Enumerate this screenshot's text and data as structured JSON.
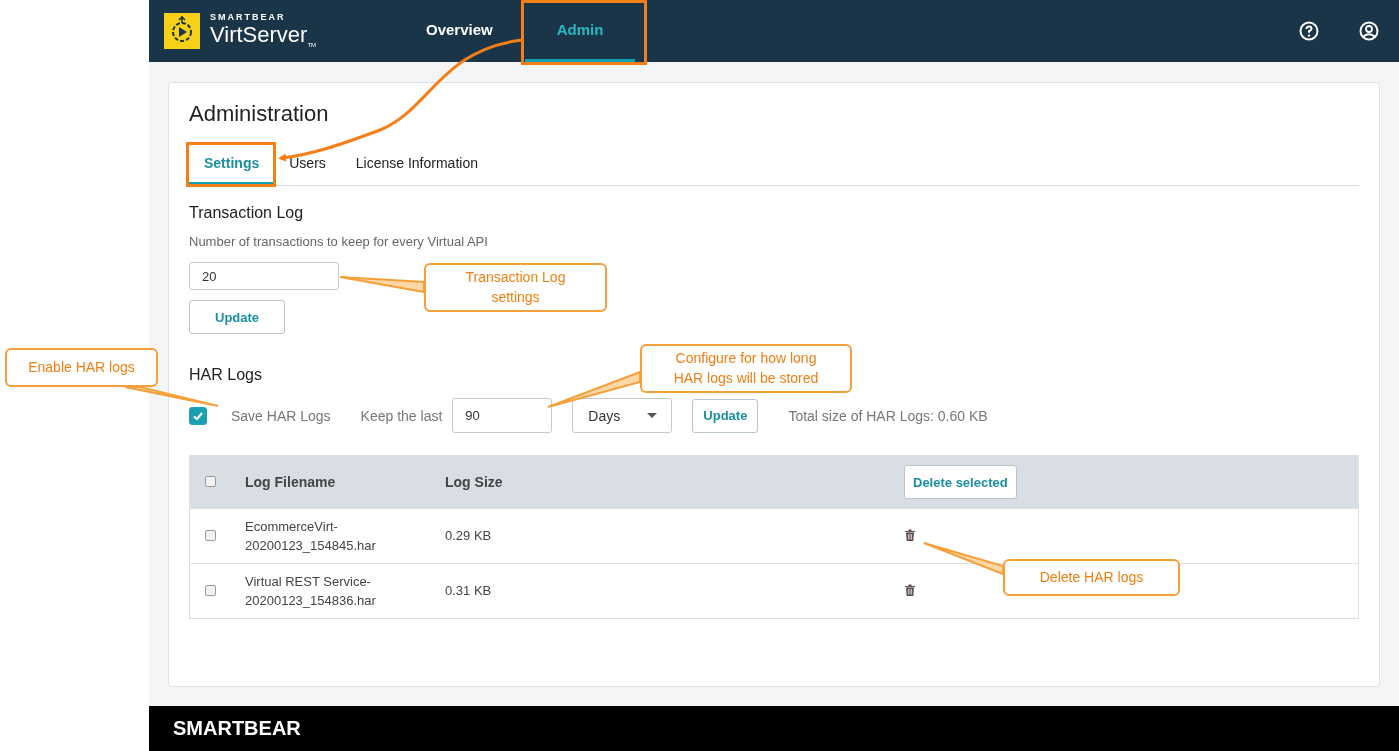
{
  "header": {
    "brand_top": "SMARTBEAR",
    "brand_name": "VirtServer",
    "brand_tm": "TM",
    "nav": [
      {
        "label": "Overview",
        "selected": false
      },
      {
        "label": "Admin",
        "selected": true
      }
    ]
  },
  "page_title": "Administration",
  "tabs": [
    {
      "label": "Settings",
      "selected": true
    },
    {
      "label": "Users",
      "selected": false
    },
    {
      "label": "License Information",
      "selected": false
    }
  ],
  "transaction_log": {
    "title": "Transaction Log",
    "description": "Number of transactions to keep for every Virtual API",
    "value": "20",
    "button": "Update"
  },
  "har_logs": {
    "title": "HAR Logs",
    "save_label": "Save HAR Logs",
    "save_checked": true,
    "keep_label": "Keep the last",
    "keep_value": "90",
    "unit": "Days",
    "button": "Update",
    "total": "Total size of HAR Logs: 0.60 KB"
  },
  "table": {
    "select_all_checked": false,
    "columns": [
      "Log Filename",
      "Log Size"
    ],
    "delete_button": "Delete selected",
    "rows": [
      {
        "checked": false,
        "filename": "EcommerceVirt-20200123_154845.har",
        "size": "0.29 KB"
      },
      {
        "checked": false,
        "filename": "Virtual REST Service-20200123_154836.har",
        "size": "0.31 KB"
      }
    ]
  },
  "footer": {
    "brand": "SMARTBEAR"
  },
  "callouts": [
    {
      "text": "Transaction Log settings"
    },
    {
      "text": "Enable HAR logs"
    },
    {
      "text": "Configure for how long HAR logs will be stored"
    },
    {
      "text": "Delete HAR logs"
    }
  ]
}
